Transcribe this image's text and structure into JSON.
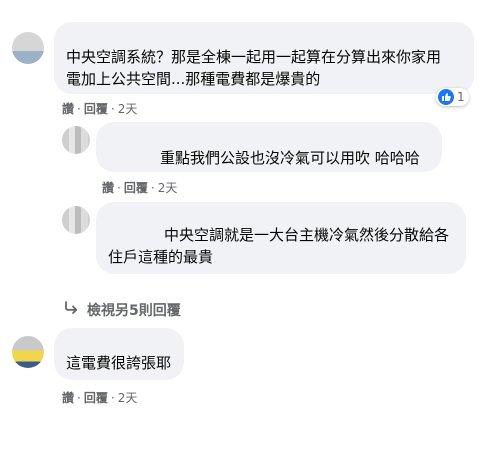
{
  "comments": [
    {
      "text_lines": [
        "中央空調系統？那是全棟一起用一起算在分算出來你家用",
        "電加上公共空間...那種電費都是爆貴的"
      ],
      "actions": {
        "like": "讚",
        "reply": "回覆",
        "time": "2天"
      },
      "reaction": {
        "icon": "like-icon",
        "count": "1"
      }
    },
    {
      "text_lines": [
        "重點我們公設也沒冷氣可以用吹 哈哈哈"
      ],
      "actions": {
        "like": "讚",
        "reply": "回覆",
        "time": "2天"
      }
    },
    {
      "text_lines": [
        "中央空調就是一大台主機冷氣然後分散給各",
        "住戶這種的最貴"
      ],
      "actions": {
        "like": "讚",
        "reply": "回覆",
        "time": "2天"
      }
    },
    {
      "text_lines": [
        "這電費很誇張耶"
      ],
      "actions": {
        "like": "讚",
        "reply": "回覆",
        "time": "2天"
      }
    }
  ],
  "more_replies": {
    "icon": "reply-arrow-icon",
    "label": "檢視另5則回覆"
  },
  "colors": {
    "bubble": "#f0f2f5",
    "meta": "#65676b",
    "like": "#1877f2"
  }
}
